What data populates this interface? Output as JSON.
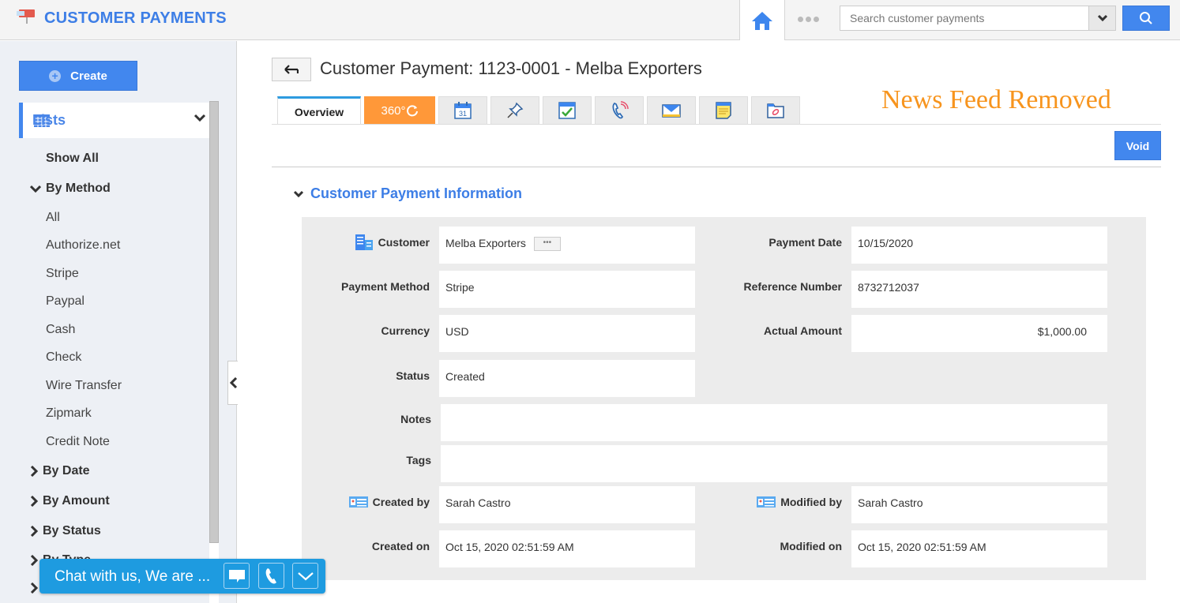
{
  "app": {
    "title": "CUSTOMER PAYMENTS",
    "logo_icon": "mailbox-icon"
  },
  "topbar": {
    "home_icon": "home-icon",
    "more_icon": "more-dots-icon",
    "search": {
      "placeholder": "Search customer payments",
      "value": ""
    },
    "search_icon": "search-icon"
  },
  "sidebar": {
    "create_label": "Create",
    "lists_label": "Lists",
    "show_all": "Show All",
    "by_method": {
      "label": "By Method",
      "items": [
        "All",
        "Authorize.net",
        "Stripe",
        "Paypal",
        "Cash",
        "Check",
        "Wire Transfer",
        "Zipmark",
        "Credit Note"
      ]
    },
    "groups": [
      "By Date",
      "By Amount",
      "By Status",
      "By Type",
      ""
    ]
  },
  "header": {
    "title": "Customer Payment: 1123-0001 - Melba Exporters",
    "tabs": [
      {
        "label": "Overview",
        "icon": ""
      },
      {
        "label": "360°",
        "icon": "refresh-icon"
      },
      {
        "label": "",
        "icon": "calendar-icon",
        "text": "31"
      },
      {
        "label": "",
        "icon": "pin-icon"
      },
      {
        "label": "",
        "icon": "task-check-icon"
      },
      {
        "label": "",
        "icon": "phone-call-icon"
      },
      {
        "label": "",
        "icon": "email-icon"
      },
      {
        "label": "",
        "icon": "notes-icon"
      },
      {
        "label": "",
        "icon": "attachment-icon"
      }
    ],
    "banner": "News Feed Removed",
    "void_label": "Void"
  },
  "section": {
    "title": "Customer Payment Information",
    "fields": {
      "customer": {
        "label": "Customer",
        "value": "Melba Exporters"
      },
      "payment_method": {
        "label": "Payment Method",
        "value": "Stripe"
      },
      "currency": {
        "label": "Currency",
        "value": "USD"
      },
      "status": {
        "label": "Status",
        "value": "Created"
      },
      "payment_date": {
        "label": "Payment Date",
        "value": "10/15/2020"
      },
      "reference_number": {
        "label": "Reference Number",
        "value": "8732712037"
      },
      "actual_amount": {
        "label": "Actual Amount",
        "value": "$1,000.00"
      },
      "notes": {
        "label": "Notes",
        "value": ""
      },
      "tags": {
        "label": "Tags",
        "value": ""
      },
      "created_by": {
        "label": "Created by",
        "value": "Sarah Castro"
      },
      "modified_by": {
        "label": "Modified by",
        "value": "Sarah Castro"
      },
      "created_on": {
        "label": "Created on",
        "value": "Oct 15, 2020 02:51:59 AM"
      },
      "modified_on": {
        "label": "Modified on",
        "value": "Oct 15, 2020 02:51:59 AM"
      }
    }
  },
  "chat": {
    "text": "Chat with us, We are ..."
  },
  "colors": {
    "accent": "#4287ee",
    "title_blue": "#3d7ee6",
    "tab_360": "#ff9839",
    "banner": "#f7941d",
    "chat": "#1e9be0"
  }
}
